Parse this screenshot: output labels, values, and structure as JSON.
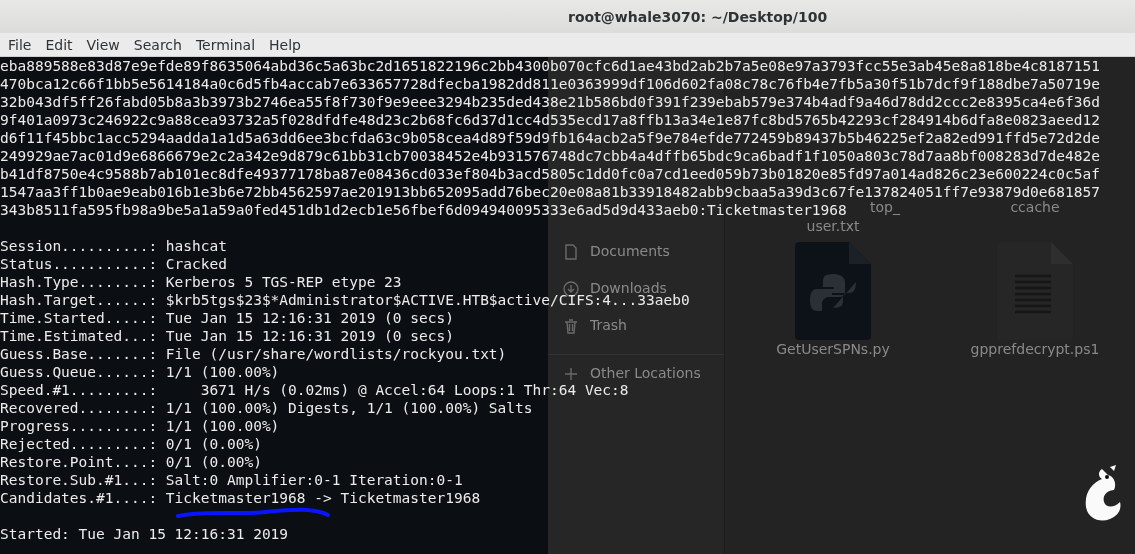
{
  "window": {
    "title": "root@whale3070: ~/Desktop/100"
  },
  "menu": [
    "File",
    "Edit",
    "View",
    "Search",
    "Terminal",
    "Help"
  ],
  "behind": {
    "sidebar": [
      {
        "kind": "documents",
        "label": "Documents"
      },
      {
        "kind": "downloads",
        "label": "Downloads"
      },
      {
        "kind": "trash",
        "label": "Trash"
      },
      {
        "kind": "other",
        "label": "Other Locations"
      }
    ],
    "files": [
      {
        "kind": "text",
        "label_top": "top_",
        "label": "user.txt"
      },
      {
        "kind": "blank",
        "label": "ccache"
      },
      {
        "kind": "python",
        "label": "GetUserSPNs.py"
      },
      {
        "kind": "document",
        "label": "gpprefdecrypt.ps1"
      }
    ]
  },
  "terminal": {
    "blocks": [
      [
        "eba889588e83d87e9efde89f8635064abd36c5a63bc2d1651822196c2bb4300b070cfc6d1ae43bd2ab2b7a5e08e97a3793fcc55e3ab45e8a818be4c8187151",
        "470bca12c66f1bb5e5614184a0c6d5fb4accab7e633657728dfecba1982dd811e0363999df106d602fa08c78c76fb4e7fb5a30f51b7dcf9f188dbe7a50719e",
        "32b043df5ff26fabd05b8a3b3973b2746ea55f8f730f9e9eee3294b235ded438e21b586bd0f391f239ebab579e374b4adf9a46d78dd2ccc2e8395ca4e6f36d",
        "9f401a0973c246922c9a88cea93732a5f028dfdfe48d23c2b68fc6d37d1cc4d535ecd17a8ffb13a34e1e87fc8bd5765b42293cf284914b6dfa8e0823aeed12",
        "d6f11f45bbc1acc5294aadda1a1d5a63dd6ee3bcfda63c9b058cea4d89f59d9fb164acb2a5f9e784efde772459b89437b5b46225ef2a82ed991ffd5e72d2de",
        "249929ae7ac01d9e6866679e2c2a342e9d879c61bb31cb70038452e4b931576748dc7cbb4a4dffb65bdc9ca6badf1f1050a803c78d7aa8bf008283d7de482e",
        "b41df8750e4c9588b7ab101ec8dfe49377178ba87e08436cd033ef804b3acd5805c1dd0fc0a7cd1eed059b73b01820e85fd97a014ad826c23e600224c0c5af",
        "1547aa3ff1b0ae9eab016b1e3b6e72bb4562597ae201913bb652095add76bec20e08a81b33918482abb9cbaa5a39d3c67fe137824051ff7e93879d0e681857",
        "343b8511fa595fb98a9be5a1a59a0fed451db1d2ecb1e56fbef6d094940095333e6ad5d9d433aeb0:Ticketmaster1968"
      ],
      [
        "Session..........: hashcat",
        "Status...........: Cracked",
        "Hash.Type........: Kerberos 5 TGS-REP etype 23",
        "Hash.Target......: $krb5tgs$23$*Administrator$ACTIVE.HTB$active/CIFS:4...33aeb0",
        "Time.Started.....: Tue Jan 15 12:16:31 2019 (0 secs)",
        "Time.Estimated...: Tue Jan 15 12:16:31 2019 (0 secs)",
        "Guess.Base.......: File (/usr/share/wordlists/rockyou.txt)",
        "Guess.Queue......: 1/1 (100.00%)",
        "Speed.#1.........:     3671 H/s (0.02ms) @ Accel:64 Loops:1 Thr:64 Vec:8",
        "Recovered........: 1/1 (100.00%) Digests, 1/1 (100.00%) Salts",
        "Progress.........: 1/1 (100.00%)",
        "Rejected.........: 0/1 (0.00%)",
        "Restore.Point....: 0/1 (0.00%)",
        "Restore.Sub.#1...: Salt:0 Amplifier:0-1 Iteration:0-1",
        "Candidates.#1....: Ticketmaster1968 -> Ticketmaster1968"
      ],
      [
        "Started: Tue Jan 15 12:16:31 2019"
      ]
    ]
  }
}
